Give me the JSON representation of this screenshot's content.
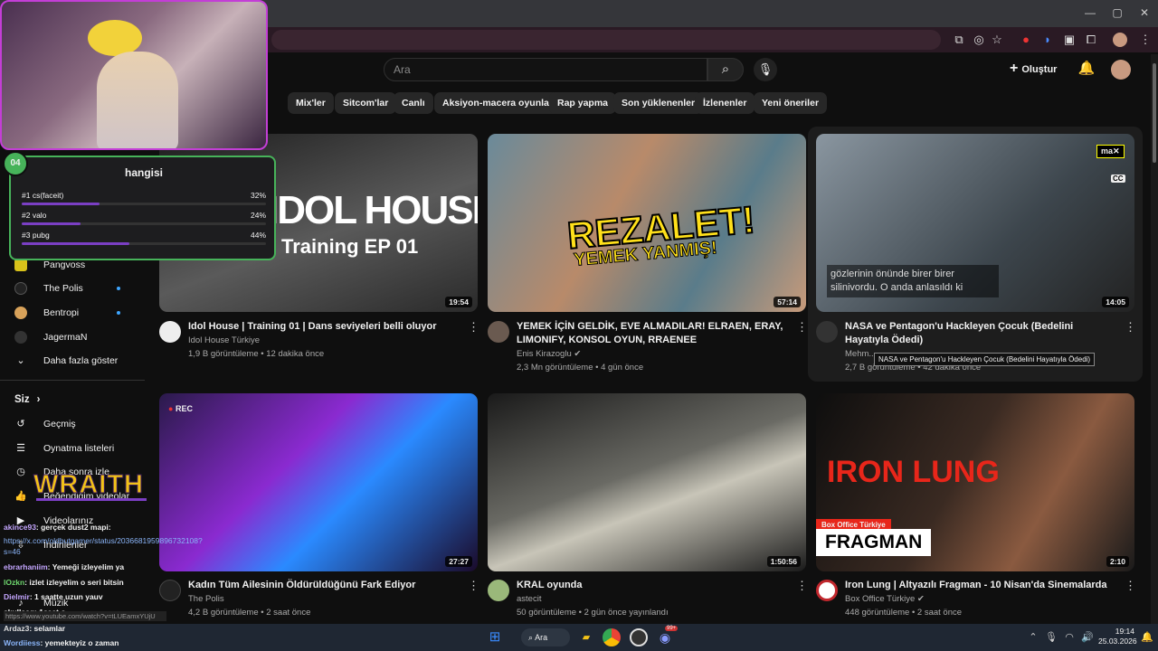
{
  "search": {
    "placeholder": "Ara"
  },
  "header": {
    "create_label": "Oluştur"
  },
  "chips": [
    "Mix'ler",
    "Sitcom'lar",
    "Canlı",
    "Aksiyon-macera oyunları",
    "Rap yapma",
    "Son yüklenenler",
    "İzlenenler",
    "Yeni öneriler"
  ],
  "chip_partial": "n",
  "sidebar": {
    "subs": [
      {
        "label": "Pangvoss",
        "live": false
      },
      {
        "label": "The Polis",
        "live": true
      },
      {
        "label": "Bentropi",
        "live": true
      },
      {
        "label": "JagermaN",
        "live": false
      }
    ],
    "show_more": "Daha fazla göster",
    "you_header": "Siz",
    "you_items": [
      "Geçmiş",
      "Oynatma listeleri",
      "Daha sonra izle",
      "Beğendiğim videolar",
      "Videolarınız",
      "İndirilenler",
      "Müzik"
    ]
  },
  "videos": [
    {
      "title": "Idol House | Training 01 | Dans seviyeleri belli oluyor",
      "channel": "Idol House Türkiye",
      "meta": "1,9 B görüntüleme • 12 dakika önce",
      "duration": "19:54",
      "thumb_text": "IDOL HOUSE",
      "thumb_sub": "Training EP 01"
    },
    {
      "title": "YEMEK İÇİN GELDİK, EVE ALMADILAR! ELRAEN, ERAY, LIMONIFY, KONSOL OYUN, RRAENEE",
      "channel": "Enis Kirazoglu",
      "meta": "2,3 Mn görüntüleme • 4 gün önce",
      "duration": "57:14",
      "thumb_text": "REZALET!",
      "thumb_sub": "YEMEK YANMIŞ!"
    },
    {
      "title": "NASA ve Pentagon'u Hackleyen Çocuk (Bedelini Hayatıyla Ödedi)",
      "channel": "Mehm...",
      "meta": "2,7 B görüntüleme • 42 dakika önce",
      "duration": "14:05",
      "caption": "gözlerinin önünde birer birer silinivordu. O anda anlasıldı ki",
      "tooltip": "NASA ve Pentagon'u Hackleyen Çocuk (Bedelini Hayatıyla Ödedi)",
      "mute_label": "ma",
      "cc": "CC"
    },
    {
      "title": "Kadın Tüm Ailesinin Öldürüldüğünü Fark Ediyor",
      "channel": "The Polis",
      "meta": "4,2 B görüntüleme • 2 saat önce",
      "duration": "27:27",
      "rec": "REC"
    },
    {
      "title": "KRAL oyunda",
      "channel": "astecit",
      "meta": "50 görüntüleme • 2 gün önce yayınlandı",
      "duration": "1:50:56"
    },
    {
      "title": "Iron Lung | Altyazılı Fragman - 10 Nisan'da Sinemalarda",
      "channel": "Box Office Türkiye",
      "meta": "448 görüntüleme • 2 saat önce",
      "duration": "2:10",
      "thumb_text": "IRON LUNG",
      "badge": "Box Office Türkiye",
      "thumb_sub": "FRAGMAN"
    }
  ],
  "poll": {
    "badge": "04",
    "title": "hangisi",
    "options": [
      {
        "label": "#1 cs(faceit)",
        "pct_label": "32%",
        "pct": 32
      },
      {
        "label": "#2 valo",
        "pct_label": "24%",
        "pct": 24
      },
      {
        "label": "#3 pubg",
        "pct_label": "44%",
        "pct": 44
      }
    ]
  },
  "overlay": {
    "wraith": "WRAITH"
  },
  "chat": [
    {
      "name": "akince93",
      "text": ": gerçek dust2 mapi:"
    },
    {
      "name": "",
      "text": "https://x.com/oldbutgamer/status/2036681959896732108?s=46"
    },
    {
      "name": "ebrarhaniim",
      "text": ": Yemeği izleyelim ya"
    },
    {
      "name": "lOzkn",
      "text": ": izlet izleyelim o seri bitsin"
    },
    {
      "name": "Dielmir",
      "text": ": 1 saatte uzun yauv"
    },
    {
      "name": "skullaag",
      "text": ": 1saat o"
    },
    {
      "name": "",
      "text": "https://www.youtube.com/watch?v=tLUEamxYUjU"
    },
    {
      "name": "Ardaz3",
      "text": ": selamlar"
    },
    {
      "name": "Wordiiess",
      "text": ": yemekteyiz o zaman"
    }
  ],
  "taskbar": {
    "search_label": "Ara",
    "time": "19:14",
    "date": "25.03.2026",
    "badge": "99+"
  }
}
